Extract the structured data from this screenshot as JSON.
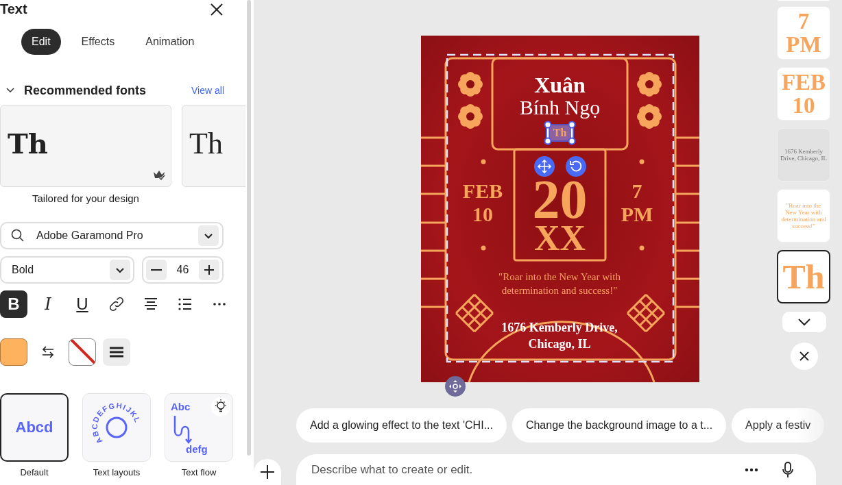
{
  "panel": {
    "title": "Text",
    "tabs": [
      {
        "label": "Edit",
        "selected": true
      },
      {
        "label": "Effects",
        "selected": false
      },
      {
        "label": "Animation",
        "selected": false
      }
    ],
    "section": {
      "title": "Recommended fonts",
      "expanded": true,
      "action": "View all"
    },
    "font_cards": [
      {
        "sample": "Th",
        "label": "Tailored for your design",
        "kind": "slab"
      },
      {
        "sample": "Th",
        "kind": "thin"
      }
    ],
    "font_field": {
      "value": "Adobe Garamond Pro"
    },
    "weight_field": {
      "value": "Bold"
    },
    "size_field": {
      "value": "46"
    },
    "format_tools": [
      {
        "kind": "toggle",
        "label": "B",
        "selected": true
      },
      {
        "kind": "toggle",
        "label": "I",
        "selected": false
      },
      {
        "kind": "toggle",
        "label": "U",
        "selected": false
      },
      {
        "kind": "link"
      },
      {
        "kind": "align"
      },
      {
        "kind": "list"
      },
      {
        "kind": "more"
      }
    ],
    "fill": {
      "color": "#ffb25e"
    },
    "layouts": [
      {
        "kind": "default",
        "label": "Default",
        "sample": "Abcd",
        "selected": true
      },
      {
        "kind": "circle",
        "label": "Text layouts",
        "sample": "ABCDEFGHIJKL",
        "selected": false
      },
      {
        "kind": "flow",
        "label": "Text flow",
        "sample": "Abc",
        "sample_end": "defg",
        "selected": false
      }
    ]
  },
  "poster": {
    "title": "Xuân",
    "subtitle": "Bính Ngọ",
    "selected_text": "Th",
    "date": [
      "FEB",
      "10"
    ],
    "year": [
      "20",
      "XX"
    ],
    "time": [
      "7",
      "PM"
    ],
    "quote": "\"Roar into the New Year with determination and success!\"",
    "address": "1676 Kemberly Drive, Chicago, IL"
  },
  "layers": [
    {
      "kind": "cut",
      "selected": false,
      "dimmed": false
    },
    {
      "kind": "big",
      "lines": [
        "7",
        "PM"
      ],
      "selected": false,
      "dimmed": false
    },
    {
      "kind": "big",
      "lines": [
        "FEB",
        "10"
      ],
      "selected": false,
      "dimmed": false
    },
    {
      "kind": "small",
      "lines": [
        "1676 Kemberly Drive, Chicago, IL"
      ],
      "selected": false,
      "dimmed": true
    },
    {
      "kind": "small",
      "lines": [
        "\"Roar into the New Year with determination and success!\""
      ],
      "selected": false,
      "dimmed": false
    },
    {
      "kind": "big",
      "lines": [
        "Th"
      ],
      "selected": true,
      "dimmed": false
    }
  ],
  "suggestions": [
    "Add a glowing effect to the text 'CHI...",
    "Change the background image to a t...",
    "Apply a festiv"
  ],
  "prompt": {
    "placeholder": "Describe what to create or edit."
  }
}
